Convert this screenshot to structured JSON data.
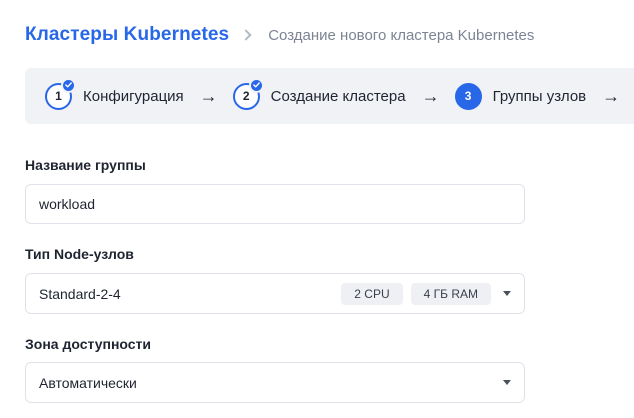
{
  "breadcrumb": {
    "root": "Кластеры Kubernetes",
    "current": "Создание нового кластера Kubernetes"
  },
  "stepper": {
    "steps": [
      {
        "number": "1",
        "label": "Конфигурация",
        "completed": true
      },
      {
        "number": "2",
        "label": "Создание кластера",
        "completed": true
      },
      {
        "number": "3",
        "label": "Группы узлов",
        "active": true
      }
    ],
    "arrow": "→"
  },
  "form": {
    "group_name": {
      "label": "Название группы",
      "value": "workload"
    },
    "node_type": {
      "label": "Тип Node-узлов",
      "value": "Standard-2-4",
      "tags": [
        "2 CPU",
        "4 ГБ RAM"
      ]
    },
    "zone": {
      "label": "Зона доступности",
      "value": "Автоматически"
    }
  },
  "colors": {
    "accent": "#2767e8",
    "stepper_bg": "#f0f2f6",
    "border": "#dfe3e9"
  },
  "icons": {
    "breadcrumb_separator": "chevron-right-icon",
    "step_done": "check-icon",
    "select_caret": "caret-down-icon"
  }
}
